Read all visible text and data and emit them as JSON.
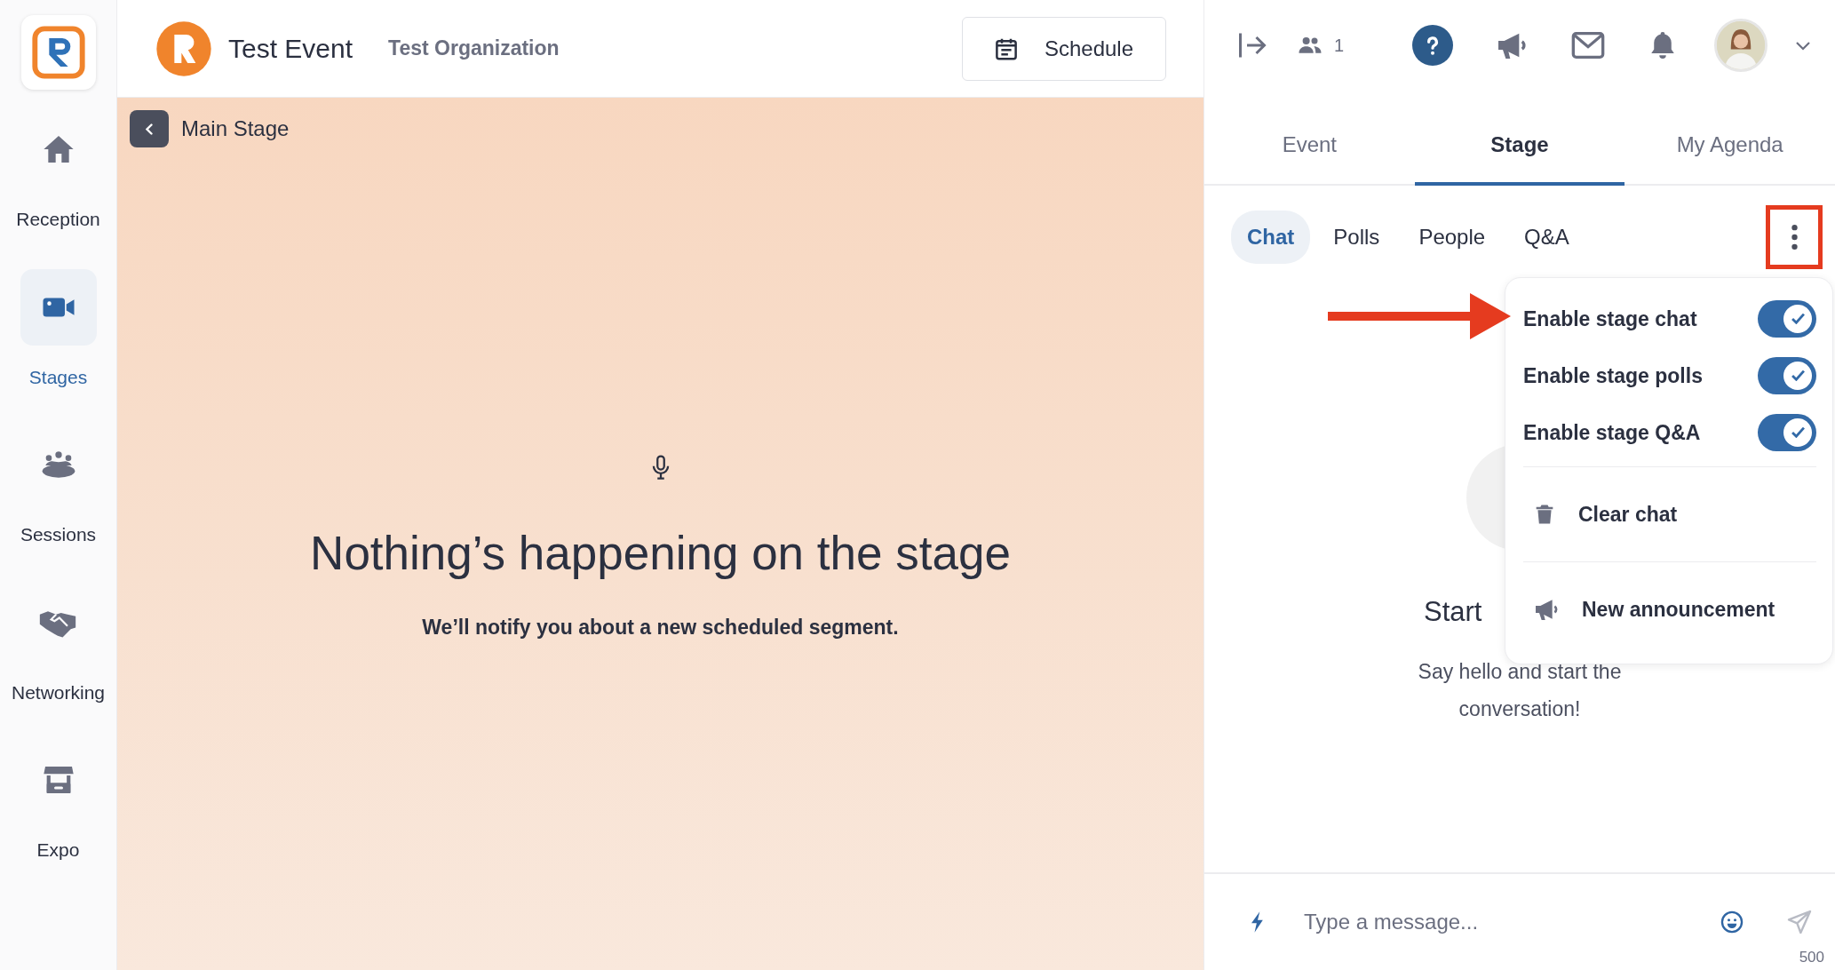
{
  "sidebar": {
    "items": [
      {
        "label": "Reception",
        "selected": false
      },
      {
        "label": "Stages",
        "selected": true
      },
      {
        "label": "Sessions",
        "selected": false
      },
      {
        "label": "Networking",
        "selected": false
      },
      {
        "label": "Expo",
        "selected": false
      }
    ]
  },
  "header": {
    "event_name": "Test Event",
    "organization": "Test Organization",
    "schedule_button": "Schedule"
  },
  "stage": {
    "title": "Main Stage",
    "heading": "Nothing’s happening on the stage",
    "subtext": "We’ll notify you about a new scheduled segment."
  },
  "top_bar": {
    "attendee_count": "1"
  },
  "tabs": [
    {
      "label": "Event",
      "selected": false
    },
    {
      "label": "Stage",
      "selected": true
    },
    {
      "label": "My Agenda",
      "selected": false
    }
  ],
  "sub_tabs": [
    {
      "label": "Chat",
      "selected": true
    },
    {
      "label": "Polls",
      "selected": false
    },
    {
      "label": "People",
      "selected": false
    },
    {
      "label": "Q&A",
      "selected": false
    }
  ],
  "menu": {
    "items": [
      {
        "kind": "toggle",
        "label": "Enable stage chat",
        "on": true
      },
      {
        "kind": "toggle",
        "label": "Enable stage polls",
        "on": true
      },
      {
        "kind": "toggle",
        "label": "Enable stage Q&A",
        "on": true
      },
      {
        "kind": "action",
        "label": "Clear chat"
      },
      {
        "kind": "action",
        "label": "New announcement"
      }
    ]
  },
  "empty_state": {
    "title": "Start",
    "text": "Say hello and start the conversation!"
  },
  "composer": {
    "placeholder": "Type a message...",
    "char_limit": "500"
  }
}
